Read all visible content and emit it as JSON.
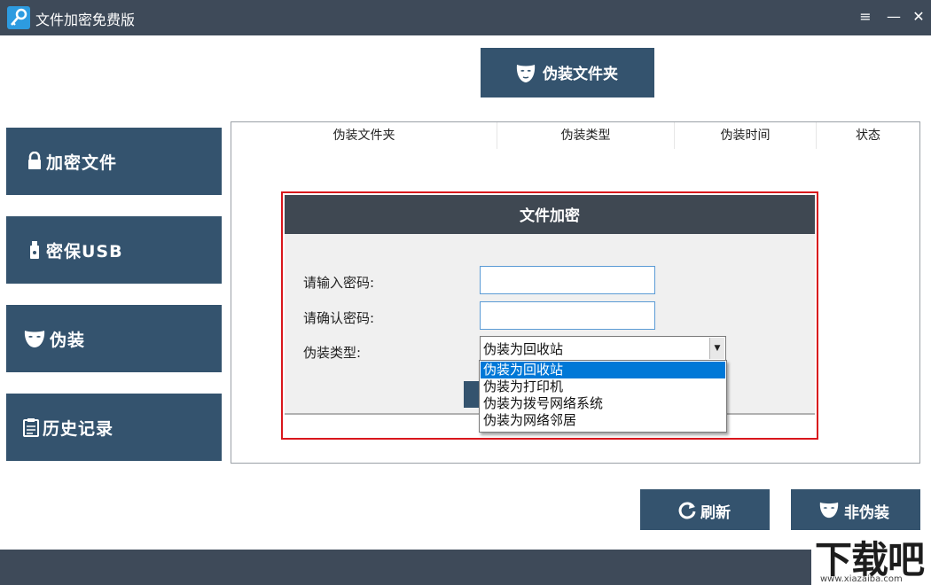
{
  "window": {
    "title": "文件加密免费版",
    "controls": [
      "≡",
      "—",
      "✕"
    ]
  },
  "sidebar": {
    "items": [
      {
        "label": "加密文件",
        "icon": "lock-icon"
      },
      {
        "label": "密保USB",
        "icon": "usb-icon"
      },
      {
        "label": "伪装",
        "icon": "mask-icon"
      },
      {
        "label": "历史记录",
        "icon": "clipboard-icon"
      }
    ]
  },
  "toolbar": {
    "disguise_folder_label": "伪装文件夹"
  },
  "table": {
    "columns": [
      "伪装文件夹",
      "伪装类型",
      "伪装时间",
      "状态"
    ]
  },
  "dialog": {
    "title": "文件加密",
    "password_label": "请输入密码:",
    "confirm_label": "请确认密码:",
    "type_label": "伪装类型:",
    "password_value": "",
    "confirm_value": "",
    "selected_type": "伪装为回收站",
    "options": [
      "伪装为回收站",
      "伪装为打印机",
      "伪装为拨号网络系统",
      "伪装为网络邻居"
    ]
  },
  "actions": {
    "refresh_label": "刷新",
    "undisguise_label": "非伪装"
  },
  "watermark": {
    "text": "下载吧",
    "url": "www.xiazaiba.com"
  },
  "colors": {
    "button": "#34536e",
    "titlebar": "#3e4a59",
    "highlight": "#d9161c",
    "selection": "#0078d7"
  }
}
